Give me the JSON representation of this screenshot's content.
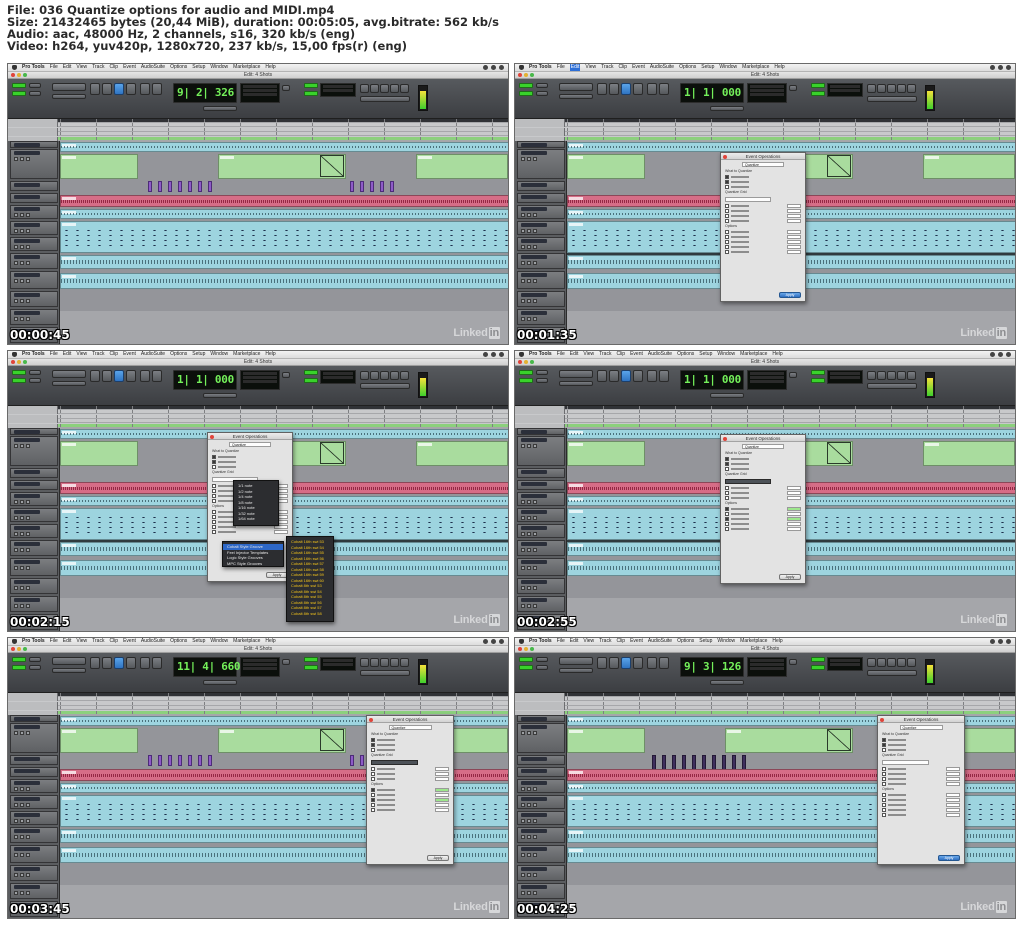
{
  "header": {
    "file_line": "File: 036 Quantize options for audio and MIDI.mp4",
    "size_line": "Size: 21432465 bytes (20,44 MiB), duration: 00:05:05, avg.bitrate: 562 kb/s",
    "audio_line": "Audio: aac, 48000 Hz, 2 channels, s16, 320 kb/s (eng)",
    "video_line": "Video: h264, yuv420p, 1280x720, 237 kb/s, 15,00 fps(r) (eng)"
  },
  "app": {
    "menu": [
      "Pro Tools",
      "File",
      "Edit",
      "View",
      "Track",
      "Clip",
      "Event",
      "AudioSuite",
      "Options",
      "Setup",
      "Window",
      "Marketplace",
      "Help"
    ],
    "window_title": "Edit: 4 Shots"
  },
  "thumbnails": [
    {
      "timestamp": "00:00:45",
      "counter": "9| 2| 326",
      "menu_highlight": ""
    },
    {
      "timestamp": "00:01:35",
      "counter": "1| 1| 000",
      "menu_highlight": "Edit"
    },
    {
      "timestamp": "00:02:15",
      "counter": "1| 1| 000",
      "menu_highlight": ""
    },
    {
      "timestamp": "00:02:55",
      "counter": "1| 1| 000",
      "menu_highlight": ""
    },
    {
      "timestamp": "00:03:45",
      "counter": "11| 4| 660",
      "menu_highlight": ""
    },
    {
      "timestamp": "00:04:25",
      "counter": "9| 3| 126",
      "menu_highlight": ""
    }
  ],
  "dialog": {
    "title": "Event Operations",
    "operation": "Quantize",
    "what_to_quantize": "What to Quantize",
    "quantize_grid": "Quantize Grid",
    "options": "Options",
    "apply": "Apply"
  },
  "grid_menu": [
    "1/1 note",
    "1/2 note",
    "1/4 note",
    "1/8 note",
    "1/16 note",
    "1/32 note",
    "1/64 note"
  ],
  "groove_menu": [
    "Cobalt Style Groove",
    "Feel Injector Templates",
    "Logic Style Grooves",
    "MPC Style Grooves"
  ],
  "groove_submenu": [
    "Cobalt 16th swi 53",
    "Cobalt 16th swi 54",
    "Cobalt 16th swi 55",
    "Cobalt 16th swi 56",
    "Cobalt 16th swi 57",
    "Cobalt 16th swi 58",
    "Cobalt 16th swi 59",
    "Cobalt 16th swi 60",
    "Cobalt 8th swi 53",
    "Cobalt 8th swi 54",
    "Cobalt 8th swi 55",
    "Cobalt 8th swi 56",
    "Cobalt 8th swi 57",
    "Cobalt 8th swi 58"
  ],
  "watermark": {
    "text": "Linked",
    "box": "in"
  }
}
